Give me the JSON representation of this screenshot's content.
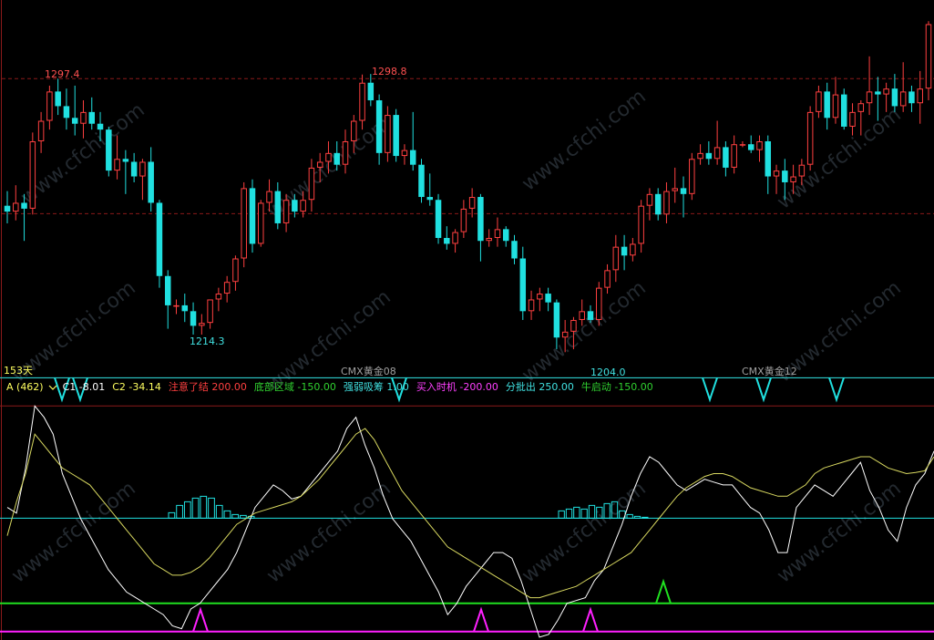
{
  "price_panel": {
    "labels": {
      "high1": "1297.4",
      "high2": "1298.8",
      "low1": "1214.3",
      "low2": "1204.0"
    },
    "bottom_labels": {
      "days": "153天",
      "contract1": "CMX黄金08",
      "contract2": "CMX黄金12"
    },
    "watermark": "www.cfchi.com"
  },
  "indicator_header": {
    "name": "A (462)",
    "items": [
      {
        "label": "C1",
        "value": "-8.01",
        "color": "#ffffff"
      },
      {
        "label": "C2",
        "value": "-34.14",
        "color": "#ffff60"
      },
      {
        "label": "注意了结",
        "value": "200.00",
        "color": "#ff4040"
      },
      {
        "label": "底部区域",
        "value": "-150.00",
        "color": "#30d030"
      },
      {
        "label": "强弱吸筹",
        "value": "1.00",
        "color": "#40e0e0"
      },
      {
        "label": "买入时机",
        "value": "-200.00",
        "color": "#ff40ff"
      },
      {
        "label": "分批出",
        "value": "250.00",
        "color": "#40e0e0"
      },
      {
        "label": "牛启动",
        "value": "-150.00",
        "color": "#30d030"
      }
    ]
  },
  "colors": {
    "up": "#ff4040",
    "down": "#20e0e0",
    "grid": "#8b1a1a",
    "c1": "#ffffff",
    "c2": "#d8d860",
    "level_cyan": "#20e0e0",
    "level_green": "#20e020",
    "level_magenta": "#ff20ff"
  },
  "chart_data": [
    {
      "type": "candlestick",
      "title": "CMX黄金",
      "ylim": [
        1196,
        1323
      ],
      "reference_lines": [
        1297.4,
        1251.3
      ],
      "ohlc": [
        [
          1254,
          1259,
          1248,
          1252
        ],
        [
          1252,
          1261,
          1249,
          1255
        ],
        [
          1255,
          1258,
          1242,
          1253
        ],
        [
          1253,
          1279,
          1251,
          1276
        ],
        [
          1276,
          1286,
          1272,
          1283
        ],
        [
          1283,
          1295,
          1280,
          1293
        ],
        [
          1293,
          1297.4,
          1285,
          1288
        ],
        [
          1288,
          1294,
          1280,
          1284
        ],
        [
          1284,
          1295,
          1278,
          1282
        ],
        [
          1282,
          1290,
          1277,
          1286
        ],
        [
          1286,
          1291,
          1280,
          1282
        ],
        [
          1282,
          1286,
          1276,
          1280
        ],
        [
          1280,
          1281,
          1264,
          1266
        ],
        [
          1266,
          1278,
          1263,
          1270
        ],
        [
          1270,
          1273,
          1258,
          1269
        ],
        [
          1269,
          1272,
          1262,
          1264
        ],
        [
          1264,
          1270,
          1256,
          1269
        ],
        [
          1269,
          1274,
          1252,
          1255
        ],
        [
          1255,
          1256,
          1226,
          1230
        ],
        [
          1230,
          1232,
          1212,
          1220
        ],
        [
          1220,
          1222,
          1217,
          1220
        ],
        [
          1220,
          1224,
          1214.3,
          1218
        ],
        [
          1218,
          1221,
          1210,
          1213
        ],
        [
          1213,
          1217,
          1210,
          1214
        ],
        [
          1214,
          1222,
          1212,
          1222
        ],
        [
          1222,
          1226,
          1218,
          1224
        ],
        [
          1224,
          1230,
          1221,
          1228
        ],
        [
          1228,
          1237,
          1225,
          1236
        ],
        [
          1236,
          1262,
          1233,
          1260
        ],
        [
          1260,
          1263,
          1238,
          1241
        ],
        [
          1241,
          1256,
          1240,
          1255
        ],
        [
          1255,
          1263,
          1252,
          1259
        ],
        [
          1259,
          1262,
          1246,
          1248
        ],
        [
          1248,
          1258,
          1245,
          1256
        ],
        [
          1256,
          1258,
          1250,
          1252
        ],
        [
          1252,
          1259,
          1250,
          1256
        ],
        [
          1256,
          1270,
          1252,
          1267
        ],
        [
          1267,
          1272,
          1262,
          1269
        ],
        [
          1269,
          1276,
          1265,
          1272
        ],
        [
          1272,
          1276,
          1266,
          1268
        ],
        [
          1268,
          1280,
          1265,
          1276
        ],
        [
          1276,
          1285,
          1272,
          1283
        ],
        [
          1283,
          1298.8,
          1280,
          1296
        ],
        [
          1296,
          1299,
          1288,
          1290
        ],
        [
          1290,
          1292,
          1268,
          1272
        ],
        [
          1272,
          1288,
          1269,
          1285
        ],
        [
          1285,
          1287,
          1269,
          1271
        ],
        [
          1271,
          1275,
          1268,
          1273
        ],
        [
          1273,
          1286,
          1266,
          1268
        ],
        [
          1268,
          1270,
          1255,
          1257
        ],
        [
          1257,
          1265,
          1254,
          1256
        ],
        [
          1256,
          1258,
          1241,
          1243
        ],
        [
          1243,
          1247,
          1239,
          1241
        ],
        [
          1241,
          1246,
          1238,
          1245
        ],
        [
          1245,
          1256,
          1243,
          1253
        ],
        [
          1253,
          1260,
          1250,
          1257
        ],
        [
          1257,
          1258,
          1235,
          1242
        ],
        [
          1242,
          1246,
          1240,
          1243
        ],
        [
          1243,
          1250,
          1240,
          1246
        ],
        [
          1246,
          1247,
          1240,
          1242
        ],
        [
          1242,
          1244,
          1234,
          1236
        ],
        [
          1236,
          1240,
          1215,
          1218
        ],
        [
          1218,
          1225,
          1215,
          1222
        ],
        [
          1222,
          1226,
          1218,
          1224
        ],
        [
          1224,
          1226,
          1218,
          1221
        ],
        [
          1221,
          1222,
          1205,
          1209
        ],
        [
          1209,
          1215,
          1204,
          1211
        ],
        [
          1211,
          1216,
          1205,
          1215
        ],
        [
          1215,
          1222,
          1213,
          1218
        ],
        [
          1218,
          1220,
          1214,
          1215
        ],
        [
          1215,
          1228,
          1213,
          1226
        ],
        [
          1226,
          1234,
          1224,
          1232
        ],
        [
          1232,
          1244,
          1228,
          1240
        ],
        [
          1240,
          1244,
          1232,
          1237
        ],
        [
          1237,
          1243,
          1235,
          1241
        ],
        [
          1241,
          1256,
          1238,
          1254
        ],
        [
          1254,
          1260,
          1249,
          1258
        ],
        [
          1258,
          1260,
          1249,
          1251
        ],
        [
          1251,
          1262,
          1248,
          1259
        ],
        [
          1259,
          1267,
          1255,
          1260
        ],
        [
          1260,
          1264,
          1250,
          1258
        ],
        [
          1258,
          1272,
          1256,
          1270
        ],
        [
          1270,
          1275,
          1268,
          1272
        ],
        [
          1272,
          1276,
          1268,
          1270
        ],
        [
          1270,
          1283,
          1268,
          1274
        ],
        [
          1274,
          1276,
          1264,
          1267
        ],
        [
          1267,
          1278,
          1265,
          1275
        ],
        [
          1275,
          1276,
          1274,
          1275
        ],
        [
          1275,
          1278,
          1272,
          1273
        ],
        [
          1273,
          1278,
          1269,
          1276
        ],
        [
          1276,
          1278,
          1258,
          1264
        ],
        [
          1264,
          1268,
          1258,
          1266
        ],
        [
          1266,
          1270,
          1256,
          1262
        ],
        [
          1262,
          1268,
          1258,
          1264
        ],
        [
          1264,
          1270,
          1261,
          1268
        ],
        [
          1268,
          1288,
          1266,
          1286
        ],
        [
          1286,
          1295,
          1284,
          1293
        ],
        [
          1293,
          1296,
          1280,
          1284
        ],
        [
          1284,
          1298,
          1282,
          1292
        ],
        [
          1292,
          1294,
          1280,
          1281
        ],
        [
          1281,
          1289,
          1278,
          1286
        ],
        [
          1286,
          1290,
          1278,
          1289
        ],
        [
          1289,
          1305,
          1285,
          1293
        ],
        [
          1293,
          1298,
          1283,
          1292
        ],
        [
          1292,
          1296,
          1286,
          1294
        ],
        [
          1294,
          1299,
          1286,
          1288
        ],
        [
          1288,
          1303,
          1286,
          1293
        ],
        [
          1293,
          1295,
          1286,
          1289
        ],
        [
          1289,
          1300,
          1282,
          1294
        ],
        [
          1294,
          1317,
          1290,
          1316
        ]
      ]
    },
    {
      "type": "line",
      "title": "A (462)",
      "ylim": [
        -215,
        215
      ],
      "reference_lines": [
        -200,
        -150,
        1,
        200,
        250
      ],
      "series": [
        {
          "name": "C1",
          "values": [
            20,
            10,
            90,
            200,
            180,
            150,
            80,
            40,
            0,
            -30,
            -60,
            -90,
            -110,
            -130,
            -140,
            -150,
            -160,
            -170,
            -190,
            -195,
            -160,
            -150,
            -130,
            -110,
            -90,
            -60,
            -20,
            20,
            40,
            60,
            50,
            35,
            40,
            60,
            80,
            100,
            120,
            160,
            180,
            130,
            90,
            40,
            0,
            -20,
            -40,
            -70,
            -100,
            -130,
            -170,
            -150,
            -120,
            -100,
            -80,
            -60,
            -60,
            -70,
            -110,
            -160,
            -210,
            -205,
            -180,
            -150,
            -145,
            -140,
            -110,
            -90,
            -50,
            -10,
            40,
            80,
            110,
            100,
            80,
            60,
            50,
            60,
            70,
            65,
            60,
            60,
            40,
            20,
            10,
            -20,
            -60,
            -60,
            20,
            40,
            60,
            50,
            40,
            60,
            80,
            100,
            50,
            20,
            -20,
            -40,
            20,
            60,
            80,
            120
          ]
        },
        {
          "name": "C2",
          "values": [
            -30,
            30,
            80,
            150,
            130,
            110,
            90,
            80,
            70,
            60,
            40,
            20,
            0,
            -20,
            -40,
            -60,
            -80,
            -90,
            -100,
            -100,
            -95,
            -85,
            -70,
            -50,
            -30,
            -10,
            0,
            10,
            15,
            20,
            25,
            30,
            40,
            55,
            70,
            90,
            110,
            130,
            150,
            160,
            140,
            110,
            80,
            50,
            30,
            10,
            -10,
            -30,
            -50,
            -60,
            -70,
            -80,
            -90,
            -100,
            -110,
            -120,
            -130,
            -140,
            -140,
            -135,
            -130,
            -125,
            -120,
            -110,
            -100,
            -90,
            -80,
            -70,
            -60,
            -40,
            -20,
            0,
            20,
            40,
            55,
            65,
            75,
            80,
            80,
            75,
            65,
            55,
            50,
            45,
            40,
            40,
            50,
            60,
            80,
            90,
            95,
            100,
            105,
            110,
            110,
            100,
            90,
            85,
            80,
            82,
            85,
            110
          ]
        }
      ]
    }
  ]
}
